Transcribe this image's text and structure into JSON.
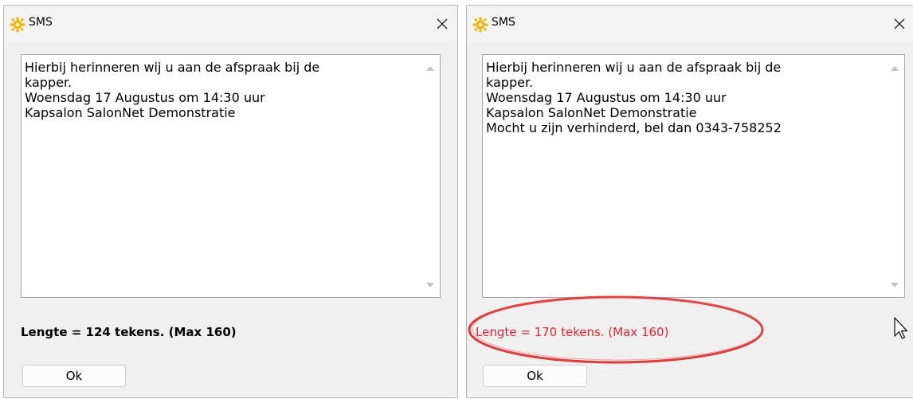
{
  "dialogs": [
    {
      "title": "SMS",
      "message_lines": [
        "Hierbij herinneren wij u aan de afspraak bij de",
        "kapper.",
        "Woensdag 17 Augustus om 14:30 uur",
        "Kapsalon SalonNet Demonstratie"
      ],
      "length_text": "Lengte = 124 tekens. (Max 160)",
      "ok_label": "Ok"
    },
    {
      "title": "SMS",
      "message_lines": [
        "Hierbij herinneren wij u aan de afspraak bij de",
        "kapper.",
        "Woensdag 17 Augustus om 14:30 uur",
        "Kapsalon SalonNet Demonstratie",
        "Mocht u zijn verhinderd, bel dan 0343-758252"
      ],
      "length_text": "Lengte = 170 tekens. (Max 160)",
      "ok_label": "Ok"
    }
  ],
  "icons": {
    "app": "sun-gear-icon",
    "close": "close-icon",
    "scroll_up": "scroll-up-arrow-icon",
    "scroll_down": "scroll-down-arrow-icon",
    "cursor": "mouse-pointer-icon"
  },
  "colors": {
    "window_bg": "#f0f0f0",
    "error_text": "#e8212e",
    "highlight_ellipse": "#e03a3a",
    "icon_gold": "#f0b400"
  }
}
